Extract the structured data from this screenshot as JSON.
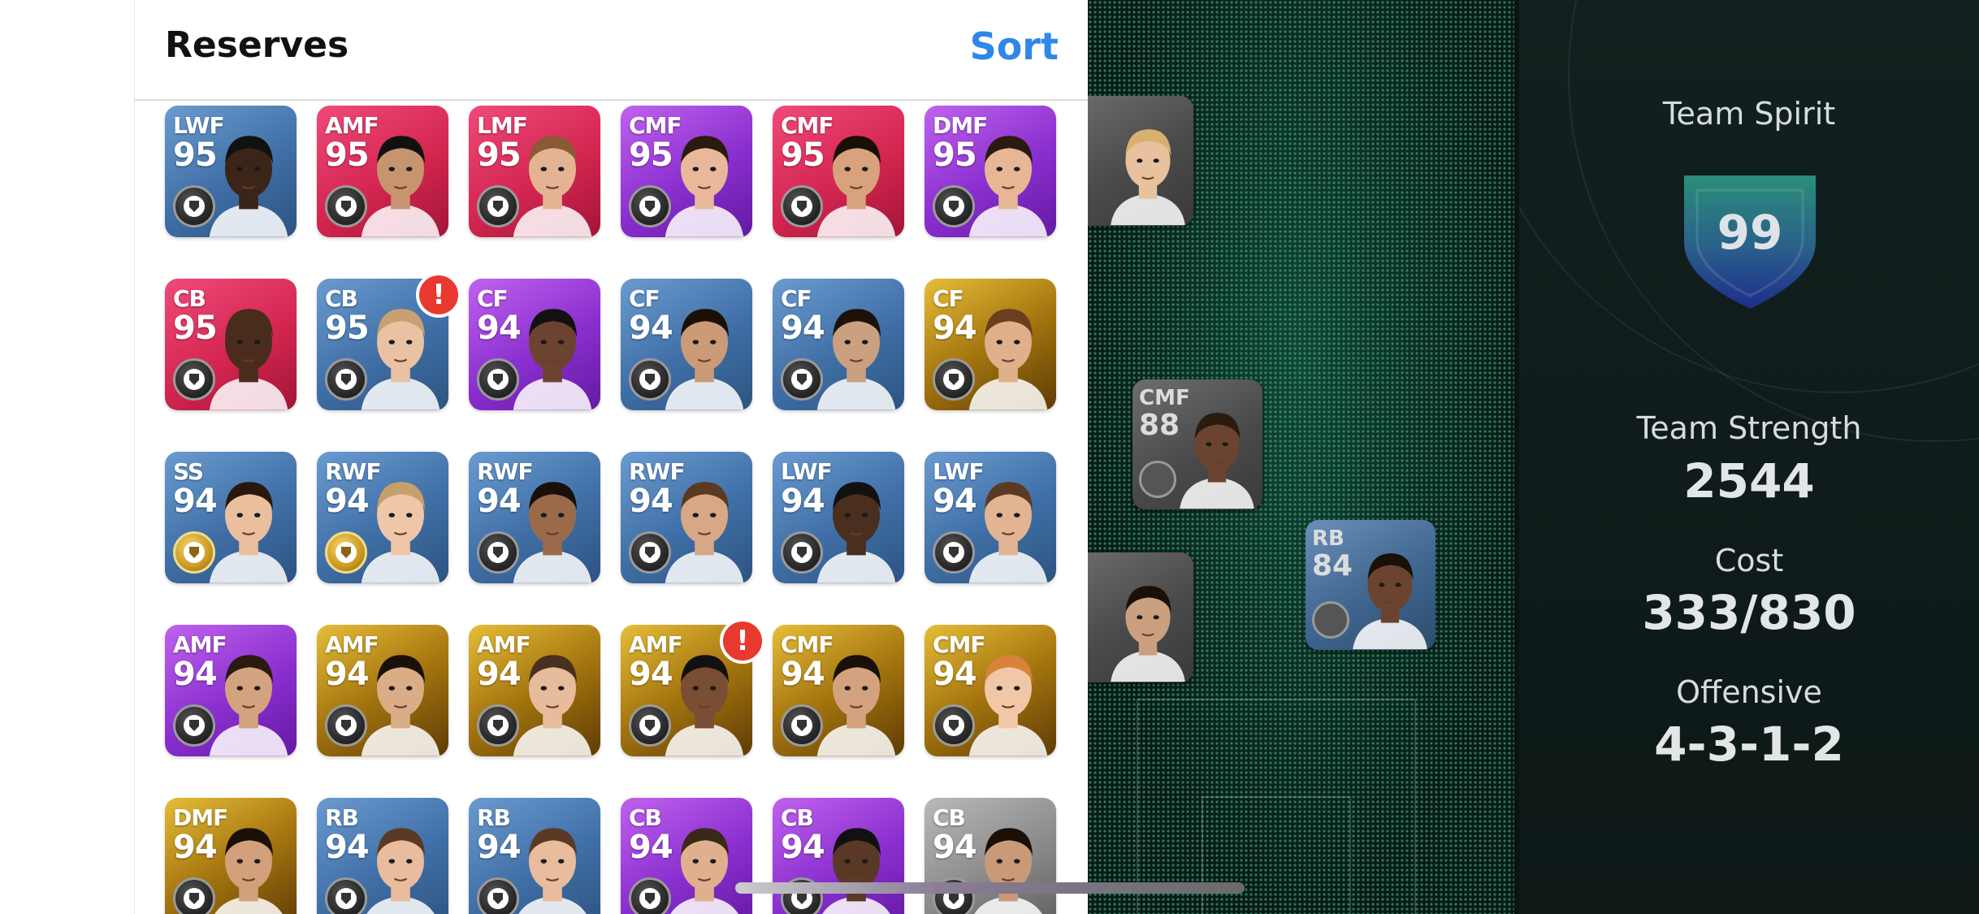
{
  "reserves": {
    "title": "Reserves",
    "sort_label": "Sort",
    "rows": [
      [
        {
          "pos": "LWF",
          "rating": "95",
          "color": "blue",
          "skin": "#3b2418",
          "hair": "#111",
          "badge": "black"
        },
        {
          "pos": "AMF",
          "rating": "95",
          "color": "red",
          "skin": "#c79470",
          "hair": "#111",
          "badge": "black"
        },
        {
          "pos": "LMF",
          "rating": "95",
          "color": "red",
          "skin": "#e4b393",
          "hair": "#8a5a36",
          "badge": "black"
        },
        {
          "pos": "CMF",
          "rating": "95",
          "color": "purple",
          "skin": "#e7b99a",
          "hair": "#2b1a10",
          "badge": "black"
        },
        {
          "pos": "CMF",
          "rating": "95",
          "color": "red",
          "skin": "#d8a27c",
          "hair": "#1a0e08",
          "badge": "black"
        },
        {
          "pos": "DMF",
          "rating": "95",
          "color": "purple",
          "skin": "#e6b695",
          "hair": "#2a1a12",
          "badge": "black"
        }
      ],
      [
        {
          "pos": "CB",
          "rating": "95",
          "color": "red",
          "skin": "#4a2c1c",
          "hair": "#4a2c1c",
          "badge": "black"
        },
        {
          "pos": "CB",
          "rating": "95",
          "color": "blue",
          "skin": "#e9c1a3",
          "hair": "#c9a070",
          "badge": "black",
          "alert": "!"
        },
        {
          "pos": "CF",
          "rating": "94",
          "color": "purple",
          "skin": "#6b4330",
          "hair": "#111",
          "badge": "black"
        },
        {
          "pos": "CF",
          "rating": "94",
          "color": "blue",
          "skin": "#cc9a76",
          "hair": "#1a1008",
          "badge": "black"
        },
        {
          "pos": "CF",
          "rating": "94",
          "color": "blue",
          "skin": "#caa080",
          "hair": "#1c120a",
          "badge": "black"
        },
        {
          "pos": "CF",
          "rating": "94",
          "color": "gold",
          "skin": "#e0b08a",
          "hair": "#6a3e1e",
          "badge": "black"
        }
      ],
      [
        {
          "pos": "SS",
          "rating": "94",
          "color": "blue",
          "skin": "#e9bf9e",
          "hair": "#2a180e",
          "badge": "gold"
        },
        {
          "pos": "RWF",
          "rating": "94",
          "color": "blue",
          "skin": "#efc6a8",
          "hair": "#c6a06a",
          "badge": "gold"
        },
        {
          "pos": "RWF",
          "rating": "94",
          "color": "blue",
          "skin": "#9a6a4a",
          "hair": "#1a100a",
          "badge": "black"
        },
        {
          "pos": "RWF",
          "rating": "94",
          "color": "blue",
          "skin": "#d8a886",
          "hair": "#5a3a20",
          "badge": "black"
        },
        {
          "pos": "LWF",
          "rating": "94",
          "color": "blue",
          "skin": "#4a2e1e",
          "hair": "#111",
          "badge": "black"
        },
        {
          "pos": "LWF",
          "rating": "94",
          "color": "blue",
          "skin": "#e2b494",
          "hair": "#5a3a24",
          "badge": "black"
        }
      ],
      [
        {
          "pos": "AMF",
          "rating": "94",
          "color": "purple",
          "skin": "#d3a27e",
          "hair": "#2a1a10",
          "badge": "black"
        },
        {
          "pos": "AMF",
          "rating": "94",
          "color": "gold",
          "skin": "#d9ae86",
          "hair": "#1a1008",
          "badge": "black"
        },
        {
          "pos": "AMF",
          "rating": "94",
          "color": "gold",
          "skin": "#e7bc9a",
          "hair": "#4a3020",
          "badge": "black"
        },
        {
          "pos": "AMF",
          "rating": "94",
          "color": "gold",
          "skin": "#7a4e34",
          "hair": "#111",
          "badge": "black",
          "alert": "!"
        },
        {
          "pos": "CMF",
          "rating": "94",
          "color": "gold",
          "skin": "#d4a27e",
          "hair": "#1a1008",
          "badge": "black"
        },
        {
          "pos": "CMF",
          "rating": "94",
          "color": "gold",
          "skin": "#f0c8a8",
          "hair": "#d8823a",
          "badge": "black"
        }
      ],
      [
        {
          "pos": "DMF",
          "rating": "94",
          "color": "gold",
          "skin": "#d3a07c",
          "hair": "#1a1008",
          "badge": "black"
        },
        {
          "pos": "RB",
          "rating": "94",
          "color": "blue",
          "skin": "#e8bc9c",
          "hair": "#5a3a24",
          "badge": "black"
        },
        {
          "pos": "RB",
          "rating": "94",
          "color": "blue",
          "skin": "#e8bc9c",
          "hair": "#5a3a24",
          "badge": "black"
        },
        {
          "pos": "CB",
          "rating": "94",
          "color": "purple",
          "skin": "#e0b08e",
          "hair": "#3a2818",
          "badge": "black"
        },
        {
          "pos": "CB",
          "rating": "94",
          "color": "purple",
          "skin": "#5a3826",
          "hair": "#111",
          "badge": "black"
        },
        {
          "pos": "CB",
          "rating": "94",
          "color": "grey",
          "skin": "#c89a78",
          "hair": "#1a1008",
          "badge": "black"
        }
      ]
    ]
  },
  "pitch": {
    "cards": [
      {
        "pos": "CMF",
        "rating": "88",
        "style": "grey",
        "skin": "#6a4430",
        "hair": "#2a1a10"
      },
      {
        "pos": "RB",
        "rating": "84",
        "style": "blue",
        "skin": "#6a4430",
        "hair": "#1a1008"
      }
    ],
    "partial_cards": [
      {
        "skin": "#e8c29e",
        "hair": "#d8b070"
      },
      {
        "skin": "#caa080",
        "hair": "#1a1008"
      }
    ]
  },
  "stats": {
    "team_spirit_label": "Team Spirit",
    "team_spirit_value": "99",
    "team_strength_label": "Team Strength",
    "team_strength_value": "2544",
    "cost_label": "Cost",
    "cost_value": "333/830",
    "offensive_label": "Offensive",
    "offensive_value": "4-3-1-2"
  },
  "colors": {
    "accent": "#2f87e8",
    "alert": "#e8392f",
    "pitch_bg": "#0b1a16",
    "stats_bg": "#12201f"
  },
  "icons": {
    "manager": "person-icon",
    "alert": "alert-icon"
  }
}
